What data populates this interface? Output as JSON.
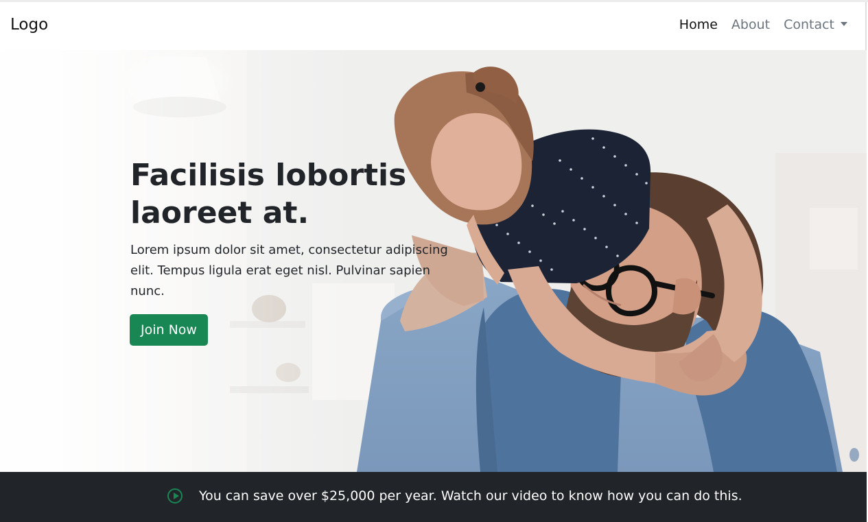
{
  "navbar": {
    "logo": "Logo",
    "items": [
      {
        "label": "Home",
        "active": true
      },
      {
        "label": "About",
        "active": false
      },
      {
        "label": "Contact",
        "active": false,
        "has_dropdown": true
      }
    ]
  },
  "hero": {
    "title": "Facilisis lobortis laoreet at.",
    "text": "Lorem ipsum dolor sit amet, consectetur adipiscing elit. Tempus ligula erat eget nisl. Pulvinar sapien nunc.",
    "button_label": "Join Now"
  },
  "promo": {
    "icon": "play-circle-icon",
    "text": "You can save over $25,000 per year. Watch our video to know how you can do this."
  },
  "colors": {
    "accent": "#198754",
    "footer_bg": "#212529"
  }
}
